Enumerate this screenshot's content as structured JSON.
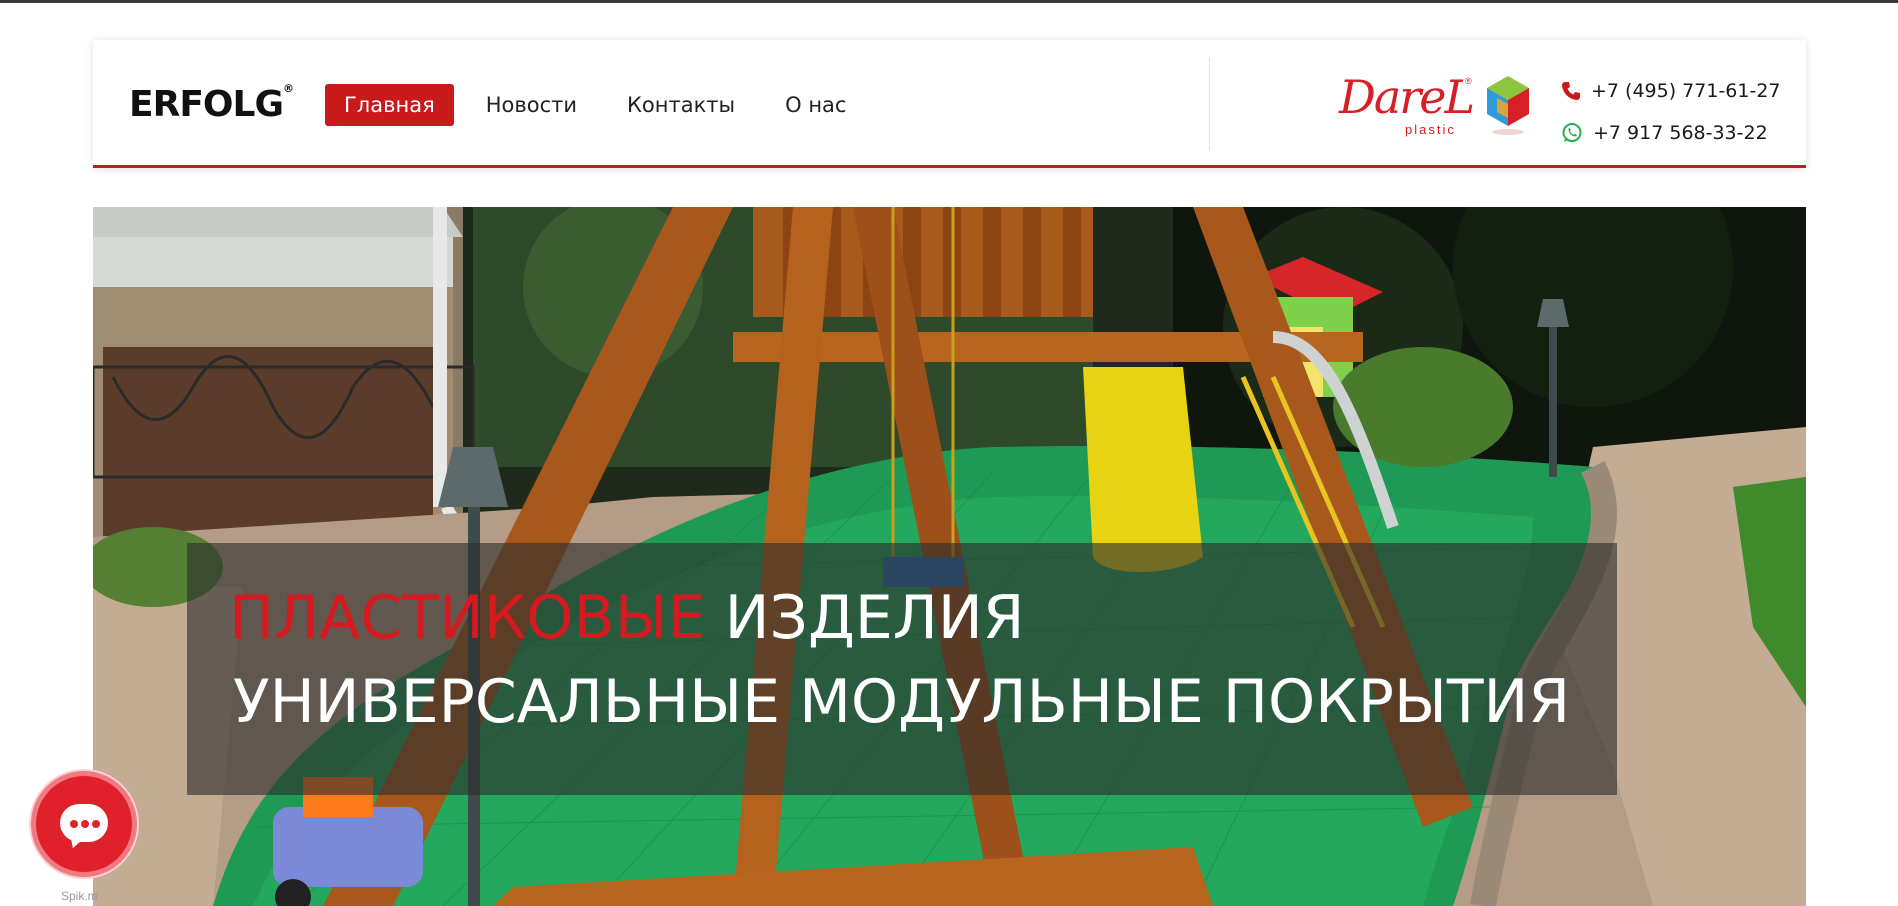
{
  "brand": {
    "logo_text": "ERFOLG",
    "logo_reg": "®",
    "accent": "#c9191b"
  },
  "nav": [
    {
      "label": "Главная",
      "active": true
    },
    {
      "label": "Новости",
      "active": false
    },
    {
      "label": "Контакты",
      "active": false
    },
    {
      "label": "О нас",
      "active": false
    }
  ],
  "partner": {
    "word": "DareL",
    "sub": "plastic",
    "reg": "®"
  },
  "contacts": {
    "phone1": {
      "icon": "phone-icon",
      "number": "+7 (495) 771-61-27"
    },
    "phone2": {
      "icon": "whatsapp-icon",
      "number": "+7 917 568-33-22"
    }
  },
  "hero": {
    "line1_red": "ПЛАСТИКОВЫЕ",
    "line1_white": " ИЗДЕЛИЯ",
    "line2": "УНИВЕРСАЛЬНЫЕ МОДУЛЬНЫЕ ПОКРЫТИЯ",
    "image_icon": "playground-photo"
  },
  "chat_widget": {
    "icon": "chat-icon",
    "label": "Spik.m"
  }
}
